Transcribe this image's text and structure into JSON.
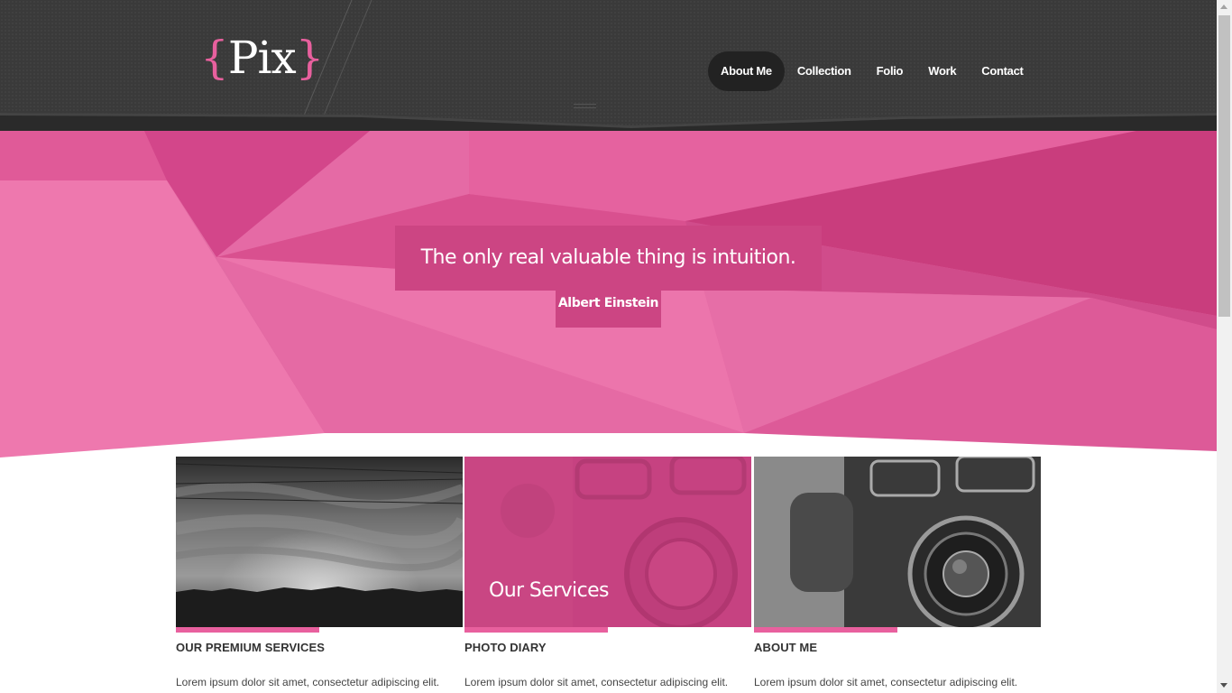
{
  "header": {
    "logo": {
      "open_brace": "{",
      "text": "Pix",
      "close_brace": "}"
    },
    "nav": [
      {
        "label": "About Me",
        "active": true
      },
      {
        "label": "Collection",
        "active": false
      },
      {
        "label": "Folio",
        "active": false
      },
      {
        "label": "Work",
        "active": false
      },
      {
        "label": "Contact",
        "active": false
      }
    ]
  },
  "hero": {
    "quote": "The only real valuable thing is intuition.",
    "author": "Albert Einstein"
  },
  "cards": [
    {
      "title": "OUR PREMIUM SERVICES",
      "text_line1": "Lorem ipsum dolor sit amet, consectetur adipiscing elit.",
      "overlay_title": ""
    },
    {
      "title": "PHOTO DIARY",
      "text_line1": "Lorem ipsum dolor sit amet, consectetur adipiscing elit.",
      "overlay_title": "Our Services"
    },
    {
      "title": "ABOUT ME",
      "text_line1": "Lorem ipsum dolor sit amet, consectetur adipiscing elit.",
      "overlay_title": ""
    }
  ],
  "colors": {
    "accent": "#e8609e",
    "header_bg": "#3a3a3a",
    "quote_bg": "#cc4583"
  }
}
